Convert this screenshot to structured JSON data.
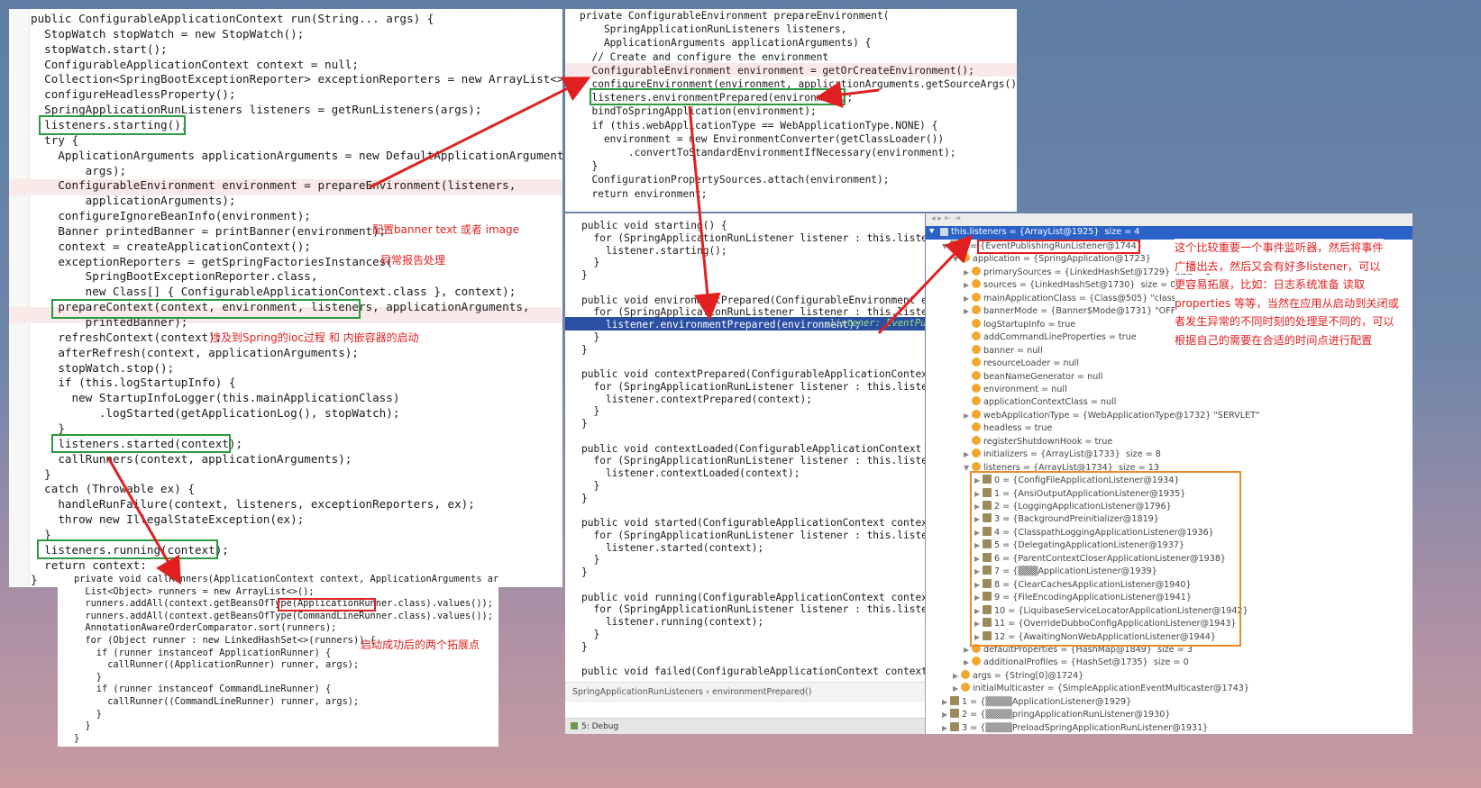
{
  "run_panel": {
    "lines": [
      "public ConfigurableApplicationContext run(String... args) {",
      "  StopWatch stopWatch = new StopWatch();",
      "  stopWatch.start();",
      "  ConfigurableApplicationContext context = null;",
      "  Collection<SpringBootExceptionReporter> exceptionReporters = new ArrayList<>();",
      "  configureHeadlessProperty();",
      "  SpringApplicationRunListeners listeners = getRunListeners(args);",
      "  listeners.starting();",
      "  try {",
      "    ApplicationArguments applicationArguments = new DefaultApplicationArguments(",
      "        args);",
      "    ConfigurableEnvironment environment = prepareEnvironment(listeners,",
      "        applicationArguments);",
      "    configureIgnoreBeanInfo(environment);",
      "    Banner printedBanner = printBanner(environment);",
      "    context = createApplicationContext();",
      "    exceptionReporters = getSpringFactoriesInstances(",
      "        SpringBootExceptionReporter.class,",
      "        new Class[] { ConfigurableApplicationContext.class }, context);",
      "    prepareContext(context, environment, listeners, applicationArguments,",
      "        printedBanner);",
      "    refreshContext(context);",
      "    afterRefresh(context, applicationArguments);",
      "    stopWatch.stop();",
      "    if (this.logStartupInfo) {",
      "      new StartupInfoLogger(this.mainApplicationClass)",
      "          .logStarted(getApplicationLog(), stopWatch);",
      "    }",
      "    listeners.started(context);",
      "    callRunners(context, applicationArguments);",
      "  }",
      "  catch (Throwable ex) {",
      "    handleRunFailure(context, listeners, exceptionReporters, ex);",
      "    throw new IllegalStateException(ex);",
      "  }",
      "  listeners.running(context);",
      "  return context;",
      "}"
    ],
    "annotations": {
      "banner": "配置banner text 或者 image",
      "exception": "异常报告处理",
      "refresh": "涉及到Spring的ioc过程 和 内嵌容器的启动"
    }
  },
  "prepare_env_panel": {
    "lines": [
      "private ConfigurableEnvironment prepareEnvironment(",
      "    SpringApplicationRunListeners listeners,",
      "    ApplicationArguments applicationArguments) {",
      "  // Create and configure the environment",
      "  ConfigurableEnvironment environment = getOrCreateEnvironment();",
      "  configureEnvironment(environment, applicationArguments.getSourceArgs());",
      "  listeners.environmentPrepared(environment);",
      "  bindToSpringApplication(environment);",
      "  if (this.webApplicationType == WebApplicationType.NONE) {",
      "    environment = new EnvironmentConverter(getClassLoader())",
      "        .convertToStandardEnvironmentIfNecessary(environment);",
      "  }",
      "  ConfigurationPropertySources.attach(environment);",
      "  return environment;"
    ]
  },
  "listeners_panel": {
    "lines": [
      "public void starting() {",
      "  for (SpringApplicationRunListener listener : this.listeners) {",
      "    listener.starting();",
      "  }",
      "}",
      "",
      "public void environmentPrepared(ConfigurableEnvironment environment) {",
      "  for (SpringApplicationRunListener listener : this.listeners) {",
      "    listener.environmentPrepared(environment);",
      "  }",
      "}",
      "",
      "public void contextPrepared(ConfigurableApplicationContext context) {",
      "  for (SpringApplicationRunListener listener : this.listeners) {",
      "    listener.contextPrepared(context);",
      "  }",
      "}",
      "",
      "public void contextLoaded(ConfigurableApplicationContext context) {",
      "  for (SpringApplicationRunListener listener : this.listeners) {",
      "    listener.contextLoaded(context);",
      "  }",
      "}",
      "",
      "public void started(ConfigurableApplicationContext context) {",
      "  for (SpringApplicationRunListener listener : this.listeners) {",
      "    listener.started(context);",
      "  }",
      "}",
      "",
      "public void running(ConfigurableApplicationContext context) {",
      "  for (SpringApplicationRunListener listener : this.listeners) {",
      "    listener.running(context);",
      "  }",
      "}",
      "",
      "public void failed(ConfigurableApplicationContext context, Throwab"
    ],
    "inline_hint": "listener: EventPu",
    "breadcrumb": [
      "SpringApplicationRunListeners",
      "environmentPrepared()"
    ],
    "debug_tab": "5: Debug"
  },
  "debugger": {
    "header": "this.listeners = {ArrayList@1925}  size = 4",
    "tree": [
      {
        "depth": 1,
        "expand": "open",
        "icon": "list",
        "text": "0 = {EventPublishingRunListener@1744}"
      },
      {
        "depth": 2,
        "expand": "open",
        "icon": "f",
        "text": "application = {SpringApplication@1723}"
      },
      {
        "depth": 3,
        "expand": "closed",
        "icon": "f",
        "text": "primarySources = {LinkedHashSet@1729}  size = 1"
      },
      {
        "depth": 3,
        "expand": "closed",
        "icon": "f",
        "text": "sources = {LinkedHashSet@1730}  size = 0"
      },
      {
        "depth": 3,
        "expand": "closed",
        "icon": "f",
        "text": "mainApplicationClass = {Class@505} \"class"
      },
      {
        "depth": 3,
        "expand": "closed",
        "icon": "f",
        "text": "bannerMode = {Banner$Mode@1731} \"OFF\""
      },
      {
        "depth": 3,
        "expand": "none",
        "icon": "f",
        "text": "logStartupInfo = true"
      },
      {
        "depth": 3,
        "expand": "none",
        "icon": "f",
        "text": "addCommandLineProperties = true"
      },
      {
        "depth": 3,
        "expand": "none",
        "icon": "f",
        "text": "banner = null"
      },
      {
        "depth": 3,
        "expand": "none",
        "icon": "f",
        "text": "resourceLoader = null"
      },
      {
        "depth": 3,
        "expand": "none",
        "icon": "f",
        "text": "beanNameGenerator = null"
      },
      {
        "depth": 3,
        "expand": "none",
        "icon": "f",
        "text": "environment = null"
      },
      {
        "depth": 3,
        "expand": "none",
        "icon": "f",
        "text": "applicationContextClass = null"
      },
      {
        "depth": 3,
        "expand": "closed",
        "icon": "f",
        "text": "webApplicationType = {WebApplicationType@1732} \"SERVLET\""
      },
      {
        "depth": 3,
        "expand": "none",
        "icon": "f",
        "text": "headless = true"
      },
      {
        "depth": 3,
        "expand": "none",
        "icon": "f",
        "text": "registerShutdownHook = true"
      },
      {
        "depth": 3,
        "expand": "closed",
        "icon": "f",
        "text": "initializers = {ArrayList@1733}  size = 8"
      },
      {
        "depth": 3,
        "expand": "open",
        "icon": "f",
        "text": "listeners = {ArrayList@1734}  size = 13"
      },
      {
        "depth": 4,
        "expand": "closed",
        "icon": "list",
        "text": "0 = {ConfigFileApplicationListener@1934}"
      },
      {
        "depth": 4,
        "expand": "closed",
        "icon": "list",
        "text": "1 = {AnsiOutputApplicationListener@1935}"
      },
      {
        "depth": 4,
        "expand": "closed",
        "icon": "list",
        "text": "2 = {LoggingApplicationListener@1796}"
      },
      {
        "depth": 4,
        "expand": "closed",
        "icon": "list",
        "text": "3 = {BackgroundPreinitializer@1819}"
      },
      {
        "depth": 4,
        "expand": "closed",
        "icon": "list",
        "text": "4 = {ClasspathLoggingApplicationListener@1936}"
      },
      {
        "depth": 4,
        "expand": "closed",
        "icon": "list",
        "text": "5 = {DelegatingApplicationListener@1937}"
      },
      {
        "depth": 4,
        "expand": "closed",
        "icon": "list",
        "text": "6 = {ParentContextCloserApplicationListener@1938}"
      },
      {
        "depth": 4,
        "expand": "closed",
        "icon": "list",
        "text": "7 = {▒▒▒ApplicationListener@1939}"
      },
      {
        "depth": 4,
        "expand": "closed",
        "icon": "list",
        "text": "8 = {ClearCachesApplicationListener@1940}"
      },
      {
        "depth": 4,
        "expand": "closed",
        "icon": "list",
        "text": "9 = {FileEncodingApplicationListener@1941}"
      },
      {
        "depth": 4,
        "expand": "closed",
        "icon": "list",
        "text": "10 = {LiquibaseServiceLocatorApplicationListener@1942}"
      },
      {
        "depth": 4,
        "expand": "closed",
        "icon": "list",
        "text": "11 = {OverrideDubboConfigApplicationListener@1943}"
      },
      {
        "depth": 4,
        "expand": "closed",
        "icon": "list",
        "text": "12 = {AwaitingNonWebApplicationListener@1944}"
      },
      {
        "depth": 3,
        "expand": "closed",
        "icon": "f",
        "text": "defaultProperties = {HashMap@1849}  size = 3"
      },
      {
        "depth": 3,
        "expand": "closed",
        "icon": "f",
        "text": "additionalProfiles = {HashSet@1735}  size = 0"
      },
      {
        "depth": 2,
        "expand": "closed",
        "icon": "f",
        "text": "args = {String[0]@1724}"
      },
      {
        "depth": 2,
        "expand": "closed",
        "icon": "f",
        "text": "initialMulticaster = {SimpleApplicationEventMulticaster@1743}"
      },
      {
        "depth": 1,
        "expand": "closed",
        "icon": "list",
        "text": "1 = {▒▒▒▒ApplicationListener@1929}"
      },
      {
        "depth": 1,
        "expand": "closed",
        "icon": "list",
        "text": "2 = {▒▒▒▒pringApplicationRunListener@1930}"
      },
      {
        "depth": 1,
        "expand": "closed",
        "icon": "list",
        "text": "3 = {▒▒▒▒PreloadSpringApplicationRunListener@1931}"
      }
    ],
    "note_lines": [
      "这个比较重要一个事件监听器，然后将事件",
      "广播出去，然后又会有好多listener，可以",
      "更容易拓展，比如：日志系统准备 读取",
      "properties 等等，当然在应用从启动到关闭或",
      "者发生异常的不同时刻的处理是不同的，可以",
      "根据自己的需要在合适的时间点进行配置"
    ]
  },
  "call_runners_panel": {
    "lines": [
      "private void callRunners(ApplicationContext context, ApplicationArguments args) {",
      "  List<Object> runners = new ArrayList<>();",
      "  runners.addAll(context.getBeansOfType(ApplicationRunner.class).values());",
      "  runners.addAll(context.getBeansOfType(CommandLineRunner.class).values());",
      "  AnnotationAwareOrderComparator.sort(runners);",
      "  for (Object runner : new LinkedHashSet<>(runners)) {",
      "    if (runner instanceof ApplicationRunner) {",
      "      callRunner((ApplicationRunner) runner, args);",
      "    }",
      "    if (runner instanceof CommandLineRunner) {",
      "      callRunner((CommandLineRunner) runner, args);",
      "    }",
      "  }",
      "}"
    ],
    "annotation": "启动成功后的两个拓展点"
  }
}
